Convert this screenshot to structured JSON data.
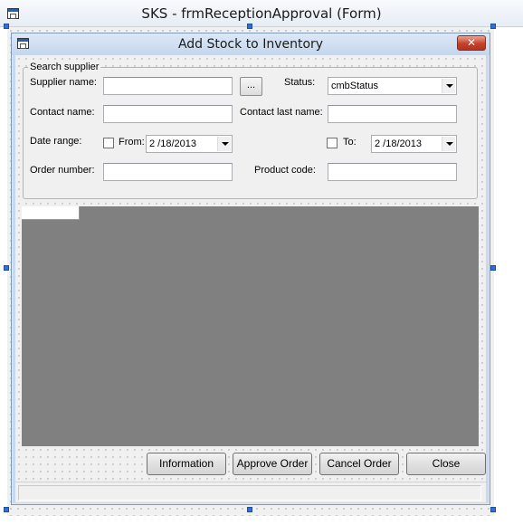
{
  "designer": {
    "title": "SKS - frmReceptionApproval (Form)"
  },
  "form": {
    "title": "Add Stock to Inventory",
    "close_symbol": "✕"
  },
  "search_group": {
    "legend": "Search supplier",
    "supplier_name_label": "Supplier name:",
    "supplier_name_value": "",
    "browse_label": "...",
    "status_label": "Status:",
    "status_value": "cmbStatus",
    "contact_name_label": "Contact name:",
    "contact_name_value": "",
    "contact_last_name_label": "Contact last name:",
    "contact_last_name_value": "",
    "date_range_label": "Date range:",
    "from_label": "From:",
    "from_checked": false,
    "from_date": "2 /18/2013",
    "to_label": "To:",
    "to_checked": false,
    "to_date": "2 /18/2013",
    "order_number_label": "Order number:",
    "order_number_value": "",
    "product_code_label": "Product code:",
    "product_code_value": ""
  },
  "buttons": {
    "information": "Information",
    "approve_order": "Approve Order",
    "cancel_order": "Cancel Order",
    "close": "Close"
  },
  "colors": {
    "grid_background": "#808080",
    "selection_handle": "#2f6fd6",
    "close_button": "#c5412b"
  }
}
